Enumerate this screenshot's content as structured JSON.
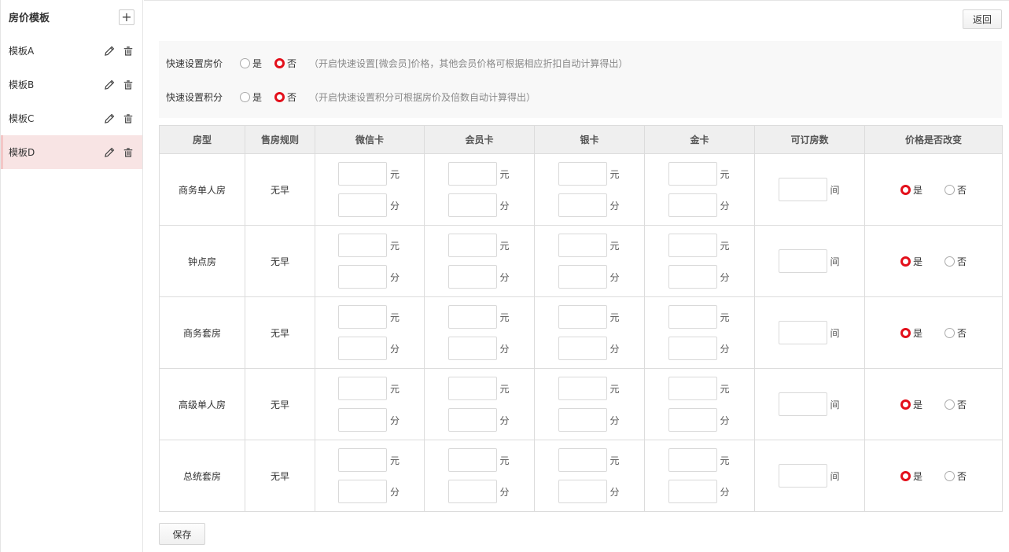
{
  "sidebar": {
    "title": "房价模板",
    "add_symbol": "+",
    "items": [
      {
        "label": "模板A",
        "active": false
      },
      {
        "label": "模板B",
        "active": false
      },
      {
        "label": "模板C",
        "active": false
      },
      {
        "label": "模板D",
        "active": true
      }
    ]
  },
  "header": {
    "back_label": "返回"
  },
  "quick_settings": [
    {
      "label": "快速设置房价",
      "yes": "是",
      "no": "否",
      "selected": "否",
      "hint": "（开启快速设置[微会员]价格，其他会员价格可根据相应折扣自动计算得出）"
    },
    {
      "label": "快速设置积分",
      "yes": "是",
      "no": "否",
      "selected": "否",
      "hint": "（开启快速设置积分可根据房价及倍数自动计算得出）"
    }
  ],
  "table": {
    "headers": [
      "房型",
      "售房规则",
      "微信卡",
      "会员卡",
      "银卡",
      "金卡",
      "可订房数",
      "价格是否改变"
    ],
    "unit_price": "元",
    "unit_points": "分",
    "unit_rooms": "间",
    "yes": "是",
    "no": "否",
    "rows": [
      {
        "room": "商务单人房",
        "rule": "无早",
        "change": "是"
      },
      {
        "room": "钟点房",
        "rule": "无早",
        "change": "是"
      },
      {
        "room": "商务套房",
        "rule": "无早",
        "change": "是"
      },
      {
        "room": "高级单人房",
        "rule": "无早",
        "change": "是"
      },
      {
        "room": "总统套房",
        "rule": "无早",
        "change": "是"
      }
    ]
  },
  "footer": {
    "save_label": "保存"
  },
  "colors": {
    "accent": "#e3101b",
    "active_bg": "#f8e4e4"
  }
}
